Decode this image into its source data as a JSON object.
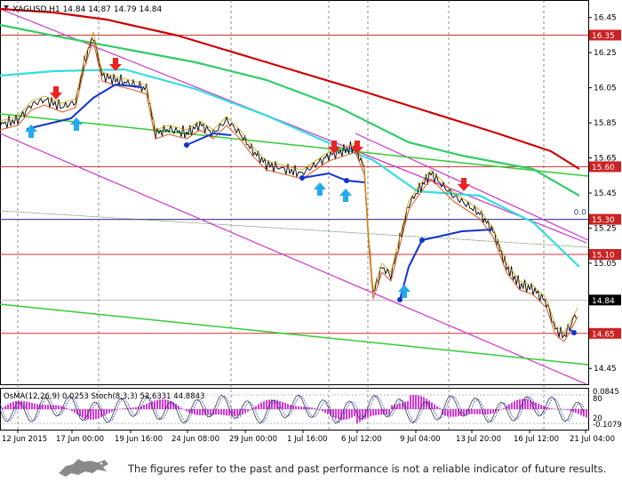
{
  "chart": {
    "header": "XAGUSD,H1  14.84 14.87 14.79 14.84",
    "osc_header": "OsMA(12,26,9) 0.0253  Stoch(8,3,3) 52.6331 44.8843",
    "current_price": "14.84",
    "price_axis": [
      "16.45",
      "16.25",
      "16.05",
      "15.85",
      "15.65",
      "15.45",
      "15.25",
      "15.05",
      "14.84",
      "14.65",
      "14.45"
    ],
    "level_labels": [
      {
        "label": "16.35",
        "value": 16.35
      },
      {
        "label": "15.60",
        "value": 15.6
      },
      {
        "label": "15.30",
        "value": 15.3
      },
      {
        "label": "15.10",
        "value": 15.1
      },
      {
        "label": "14.65",
        "value": 14.65
      }
    ],
    "fib_label": "0.0",
    "osc_axis": [
      "0.0845",
      "80",
      "20",
      "-0.1079"
    ],
    "time_axis": [
      "12 Jun 2015",
      "17 Jun 00:00",
      "19 Jun 16:00",
      "24 Jun 08:00",
      "29 Jun 00:00",
      "1 Jul 16:00",
      "6 Jul 12:00",
      "9 Jul 04:00",
      "13 Jul 20:00",
      "16 Jul 12:00",
      "21 Jul 04:00"
    ],
    "colors": {
      "ma_red": "#cc0000",
      "ma_green": "#33cc66",
      "ma_cyan": "#33dddd",
      "channel": "#cc33cc",
      "trend": "#33cc33",
      "level": "#cc3333",
      "blue": "#1133cc",
      "up_arrow": "#22aaee",
      "down_arrow": "#ee2222",
      "histogram": "#dd33dd"
    }
  },
  "chart_data": {
    "type": "line",
    "x": [
      "12 Jun 2015",
      "17 Jun 00:00",
      "19 Jun 16:00",
      "24 Jun 08:00",
      "29 Jun 00:00",
      "1 Jul 16:00",
      "6 Jul 12:00",
      "9 Jul 04:00",
      "13 Jul 20:00",
      "16 Jul 12:00",
      "21 Jul 04:00"
    ],
    "series": [
      {
        "values": [
          15.85,
          16.05,
          16.18,
          15.9,
          15.62,
          15.63,
          15.7,
          15.58,
          15.45,
          15.05,
          14.84
        ]
      },
      {
        "values": [
          16.42,
          16.3,
          16.24,
          16.16,
          16.08,
          16.0,
          15.93,
          15.83,
          15.78,
          15.7,
          15.62
        ]
      }
    ],
    "ylim": [
      14.36,
      16.55
    ],
    "grid": true
  },
  "footer": {
    "disclaimer": "The figures refer to the past and past performance is not a reliable indicator of future results."
  }
}
